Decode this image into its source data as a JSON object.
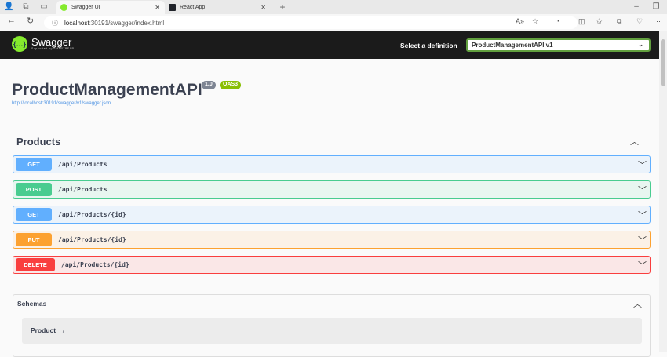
{
  "browser": {
    "tabs": [
      {
        "label": "Swagger UI",
        "active": true
      },
      {
        "label": "React App",
        "active": false
      }
    ],
    "url_host": "localhost",
    "url_rest": ":30191/swagger/index.html"
  },
  "header": {
    "brand": "Swagger",
    "brand_sub": "Supported by SMARTBEAR",
    "definition_label": "Select a definition",
    "definition_value": "ProductManagementAPI v1"
  },
  "info": {
    "title": "ProductManagementAPI",
    "version": "1.0",
    "oas": "OAS3",
    "spec_link": "http://localhost:30191/swagger/v1/swagger.json"
  },
  "section": {
    "title": "Products"
  },
  "operations": [
    {
      "method": "GET",
      "path": "/api/Products",
      "color": "#61affe"
    },
    {
      "method": "POST",
      "path": "/api/Products",
      "color": "#49cc90"
    },
    {
      "method": "GET",
      "path": "/api/Products/{id}",
      "color": "#61affe"
    },
    {
      "method": "PUT",
      "path": "/api/Products/{id}",
      "color": "#fca130"
    },
    {
      "method": "DELETE",
      "path": "/api/Products/{id}",
      "color": "#f93e3e"
    }
  ],
  "schemas": {
    "title": "Schemas",
    "models": [
      "Product"
    ]
  }
}
